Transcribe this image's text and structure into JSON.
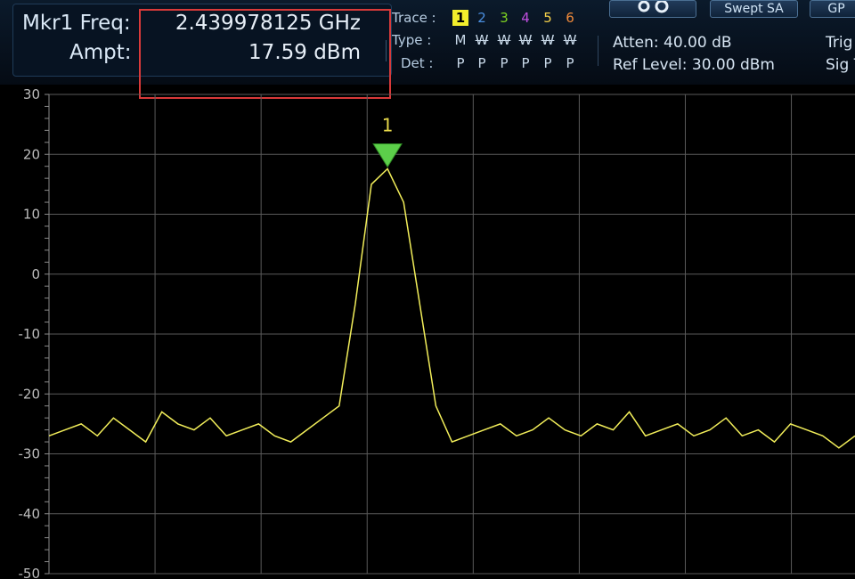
{
  "marker": {
    "freq_label": "Mkr1 Freq:",
    "freq_value": "2.439978125 GHz",
    "ampt_label": "Ampt:",
    "ampt_value": "17.59 dBm",
    "marker_number": "1",
    "highlight_color": "#d83a3a"
  },
  "trace": {
    "trace_label": "Trace :",
    "type_label": "Type :",
    "det_label": "Det :",
    "numbers": [
      "1",
      "2",
      "3",
      "4",
      "5",
      "6"
    ],
    "number_colors": [
      "#000000",
      "#4a8fe0",
      "#7ed321",
      "#c04fe0",
      "#f5d04a",
      "#f08a3a"
    ],
    "types": [
      "M",
      "W",
      "W",
      "W",
      "W",
      "W"
    ],
    "dets": [
      "P",
      "P",
      "P",
      "P",
      "P",
      "P"
    ]
  },
  "status": {
    "atten": "Atten: 40.00 dB",
    "ref_level": "Ref Level: 30.00 dBm",
    "trig": "Trig",
    "sig": "Sig T"
  },
  "toolbar": {
    "settings_icon": "gears-icon",
    "mode_label": "Swept SA",
    "gp_label": "GP"
  },
  "chart_data": {
    "type": "line",
    "title": "",
    "xlabel": "",
    "ylabel": "",
    "ylim": [
      -50,
      30
    ],
    "y_ticks": [
      "30",
      "20",
      "10",
      "0",
      "-10",
      "-20",
      "-30",
      "-40",
      "-50"
    ],
    "grid": true,
    "series": [
      {
        "color": "#f2ee5a",
        "x": [
          0,
          0.02,
          0.04,
          0.06,
          0.08,
          0.1,
          0.12,
          0.14,
          0.16,
          0.18,
          0.2,
          0.22,
          0.24,
          0.26,
          0.28,
          0.3,
          0.32,
          0.34,
          0.36,
          0.38,
          0.4,
          0.42,
          0.44,
          0.46,
          0.48,
          0.5,
          0.52,
          0.54,
          0.56,
          0.58,
          0.6,
          0.62,
          0.64,
          0.66,
          0.68,
          0.7,
          0.72,
          0.74,
          0.76,
          0.78,
          0.8,
          0.82,
          0.84,
          0.86,
          0.88,
          0.9,
          0.92,
          0.94,
          0.96,
          0.98,
          1.0
        ],
        "values": [
          -27,
          -26,
          -25,
          -27,
          -24,
          -26,
          -28,
          -23,
          -25,
          -26,
          -24,
          -27,
          -26,
          -25,
          -27,
          -28,
          -26,
          -24,
          -22,
          -5,
          15,
          17.59,
          12,
          -5,
          -22,
          -28,
          -27,
          -26,
          -25,
          -27,
          -26,
          -24,
          -26,
          -27,
          -25,
          -26,
          -23,
          -27,
          -26,
          -25,
          -27,
          -26,
          -24,
          -27,
          -26,
          -28,
          -25,
          -26,
          -27,
          -29,
          -27
        ]
      }
    ]
  }
}
